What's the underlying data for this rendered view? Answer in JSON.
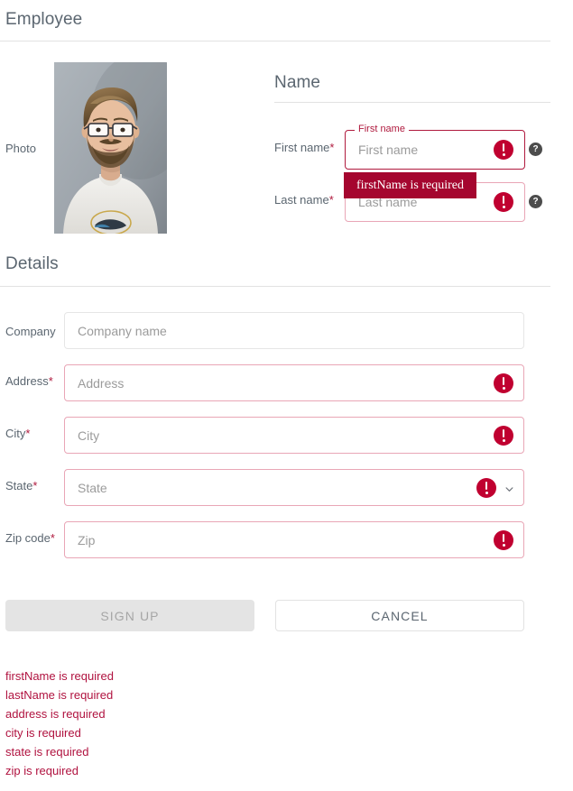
{
  "header": {
    "title": "Employee"
  },
  "photo": {
    "label": "Photo",
    "alt": "employee-portrait"
  },
  "name_section": {
    "title": "Name",
    "fields": [
      {
        "label": "First name",
        "required_mark": "*",
        "placeholder": "First name",
        "value": "",
        "floating_label": "First name",
        "error_icon": "error-icon",
        "help_icon": "?",
        "state": "invalid-focused"
      },
      {
        "label": "Last name",
        "required_mark": "*",
        "placeholder": "Last name",
        "value": "",
        "floating_label": "",
        "error_icon": "error-icon",
        "help_icon": "?",
        "state": "invalid"
      }
    ],
    "tooltip": {
      "text": "firstName is required",
      "color": "#a5062f"
    }
  },
  "details_section": {
    "title": "Details",
    "fields": [
      {
        "label": "Company",
        "required_mark": "",
        "placeholder": "Company name",
        "value": "",
        "has_error": false,
        "control": "text"
      },
      {
        "label": "Address",
        "required_mark": "*",
        "placeholder": "Address",
        "value": "",
        "has_error": true,
        "control": "text"
      },
      {
        "label": "City",
        "required_mark": "*",
        "placeholder": "City",
        "value": "",
        "has_error": true,
        "control": "text"
      },
      {
        "label": "State",
        "required_mark": "*",
        "placeholder": "State",
        "value": "",
        "has_error": true,
        "control": "select"
      },
      {
        "label": "Zip code",
        "required_mark": "*",
        "placeholder": "Zip",
        "value": "",
        "has_error": true,
        "control": "text"
      }
    ]
  },
  "actions": {
    "submit_label": "SIGN UP",
    "submit_disabled": true,
    "cancel_label": "CANCEL"
  },
  "validation_messages": [
    "firstName is required",
    "lastName is required",
    "address is required",
    "city is required",
    "state is required",
    "zip is required"
  ],
  "colors": {
    "error": "#b0123f",
    "error_icon": "#c00030",
    "tooltip_bg": "#a5062f",
    "label_text": "#5b6670",
    "placeholder": "#9b9b9b",
    "border": "#e6e6e6",
    "error_border": "#e9a6b6",
    "divider": "#e2e2e2"
  }
}
